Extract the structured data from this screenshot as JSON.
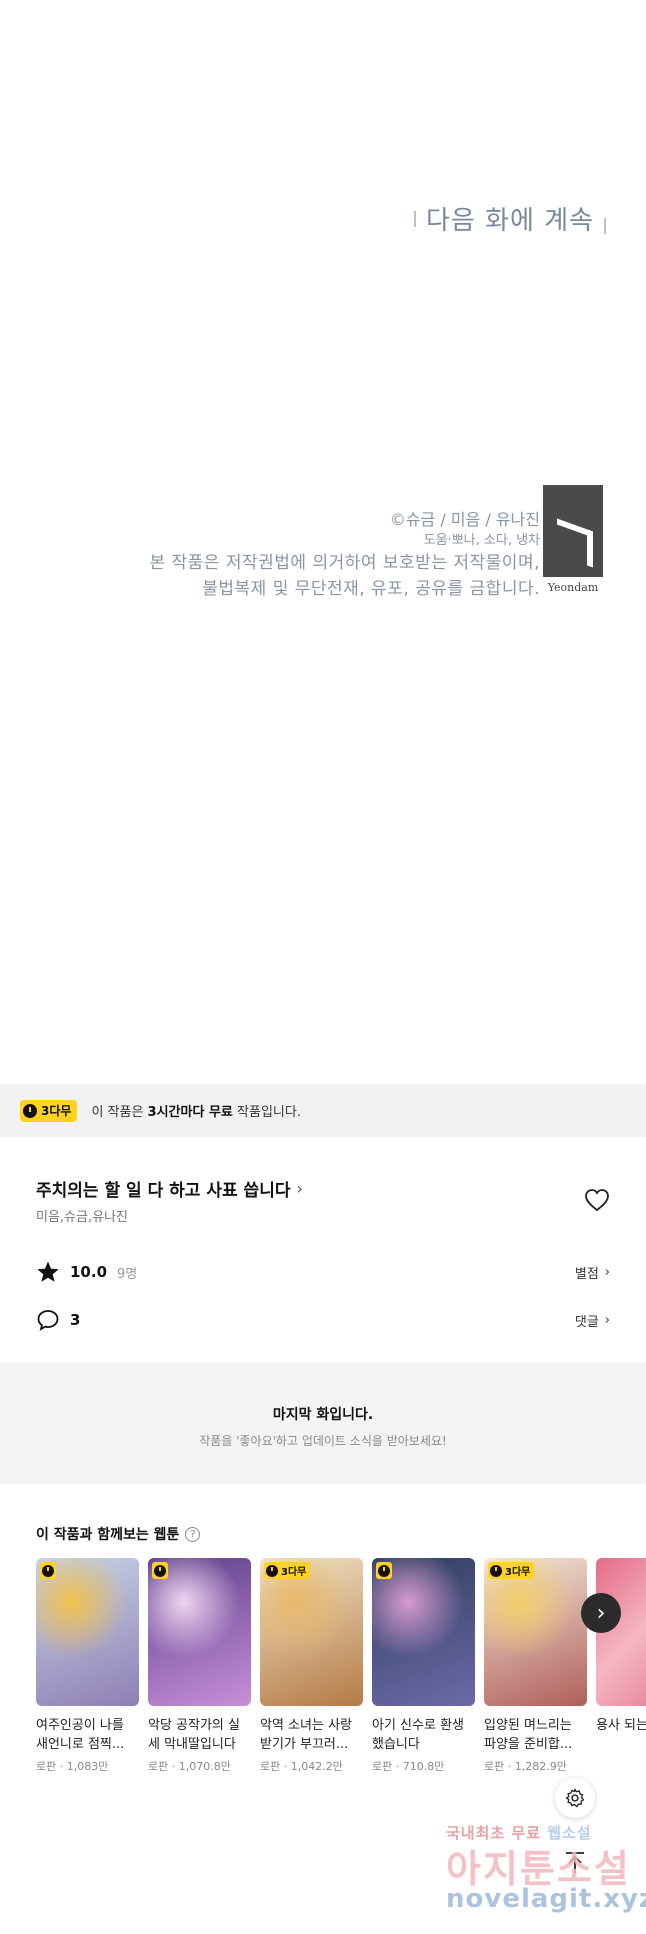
{
  "comic_end": {
    "continue_text": "다음 화에 계속",
    "credit_main": "©슈금 / 미음 / 유나진",
    "credit_staff": "도움·뽀나, 소다, 냉차",
    "copyright_line1": "본 작품은 저작권법에 의거하여 보호받는 저작물이며,",
    "copyright_line2": "불법복제 및 무단전재, 유포, 공유를 금합니다.",
    "logo_text": "Yeondam"
  },
  "banner": {
    "badge": "3다무",
    "text_prefix": "이 작품은 ",
    "text_bold": "3시간마다 무료",
    "text_suffix": " 작품입니다."
  },
  "work": {
    "title": "주치의는 할 일 다 하고 사표 씁니다",
    "chevron": "›",
    "authors": "미음,슈금,유나진",
    "rating": "10.0",
    "rating_count": "9명",
    "rating_link": "별점",
    "comments": "3",
    "comment_link": "댓글"
  },
  "last_episode": {
    "title": "마지막 화입니다.",
    "subtitle": "작품을 '좋아요'하고 업데이트 소식을 받아보세요!"
  },
  "recommendations": {
    "heading": "이 작품과 함께보는 웹툰",
    "help": "?",
    "items": [
      {
        "title": "여주인공이 나를 새언니로 점찍...",
        "meta": "로판 · 1,083만",
        "badge": "",
        "colors": [
          "#c7d4e8",
          "#8f7fb4",
          "#f2c24c"
        ]
      },
      {
        "title": "악당 공작가의 실세 막내딸입니다",
        "meta": "로판 · 1,070.8만",
        "badge": "",
        "colors": [
          "#5b3f8a",
          "#c88fd8",
          "#f0d6f0"
        ]
      },
      {
        "title": "악역 소녀는 사랑받기가 부끄러...",
        "meta": "로판 · 1,042.2만",
        "badge": "3다무",
        "colors": [
          "#f1e4c8",
          "#b47a45",
          "#e9b86a"
        ]
      },
      {
        "title": "아기 신수로 환생했습니다",
        "meta": "로판 · 710.8만",
        "badge": "",
        "colors": [
          "#2f3e5e",
          "#6c6aa8",
          "#d79ad1"
        ]
      },
      {
        "title": "입양된 며느리는 파양을 준비합...",
        "meta": "로판 · 1,282.9만",
        "badge": "3다무",
        "colors": [
          "#f3e9da",
          "#b05f5b",
          "#f2cf6a"
        ]
      }
    ],
    "partial_title": "용사 되는"
  },
  "watermark": {
    "line1a": "국내최초 무료",
    "line1b": "웹소설",
    "line2": "아지툰소설",
    "line3": "novelagit.xyz"
  }
}
